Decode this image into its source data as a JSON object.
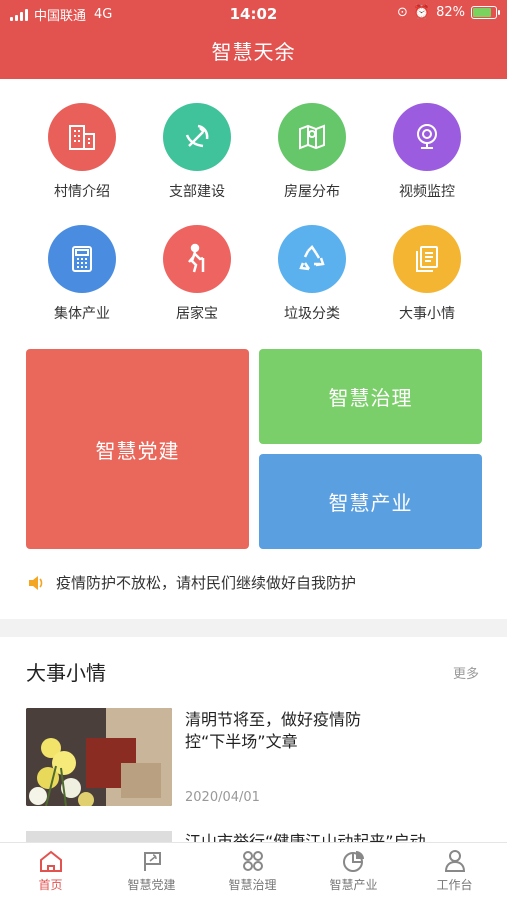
{
  "status": {
    "carrier": "中国联通",
    "network": "4G",
    "time": "14:02",
    "battery": "82%",
    "battery_level": 0.82
  },
  "header": {
    "title": "智慧天余"
  },
  "menu": [
    {
      "label": "村情介绍",
      "icon": "building-icon",
      "color": "#e9605b"
    },
    {
      "label": "支部建设",
      "icon": "party-emblem-icon",
      "color": "#40c29a"
    },
    {
      "label": "房屋分布",
      "icon": "map-icon",
      "color": "#66c66a"
    },
    {
      "label": "视频监控",
      "icon": "camera-icon",
      "color": "#9b5ce0"
    },
    {
      "label": "集体产业",
      "icon": "calculator-icon",
      "color": "#4a8de0"
    },
    {
      "label": "居家宝",
      "icon": "elderly-icon",
      "color": "#ee6461"
    },
    {
      "label": "垃圾分类",
      "icon": "recycle-icon",
      "color": "#5ab1ee"
    },
    {
      "label": "大事小情",
      "icon": "document-icon",
      "color": "#f4b533"
    }
  ],
  "tiles": {
    "party": {
      "label": "智慧党建",
      "color": "#e9685b"
    },
    "governance": {
      "label": "智慧治理",
      "color": "#7bcf6a"
    },
    "industry": {
      "label": "智慧产业",
      "color": "#5a9fe0"
    }
  },
  "notice": {
    "text": "疫情防护不放松，请村民们继续做好自我防护"
  },
  "news": {
    "title": "大事小情",
    "more": "更多",
    "items": [
      {
        "title": "清明节将至，做好疫情防控“下半场”文章",
        "date": "2020/04/01"
      },
      {
        "title": "江山市举行“健康江山动起来”启动"
      }
    ]
  },
  "tabs": [
    {
      "label": "首页",
      "icon": "home-icon",
      "active": true
    },
    {
      "label": "智慧党建",
      "icon": "flag-icon"
    },
    {
      "label": "智慧治理",
      "icon": "apps-icon"
    },
    {
      "label": "智慧产业",
      "icon": "pie-chart-icon"
    },
    {
      "label": "工作台",
      "icon": "user-icon"
    }
  ]
}
